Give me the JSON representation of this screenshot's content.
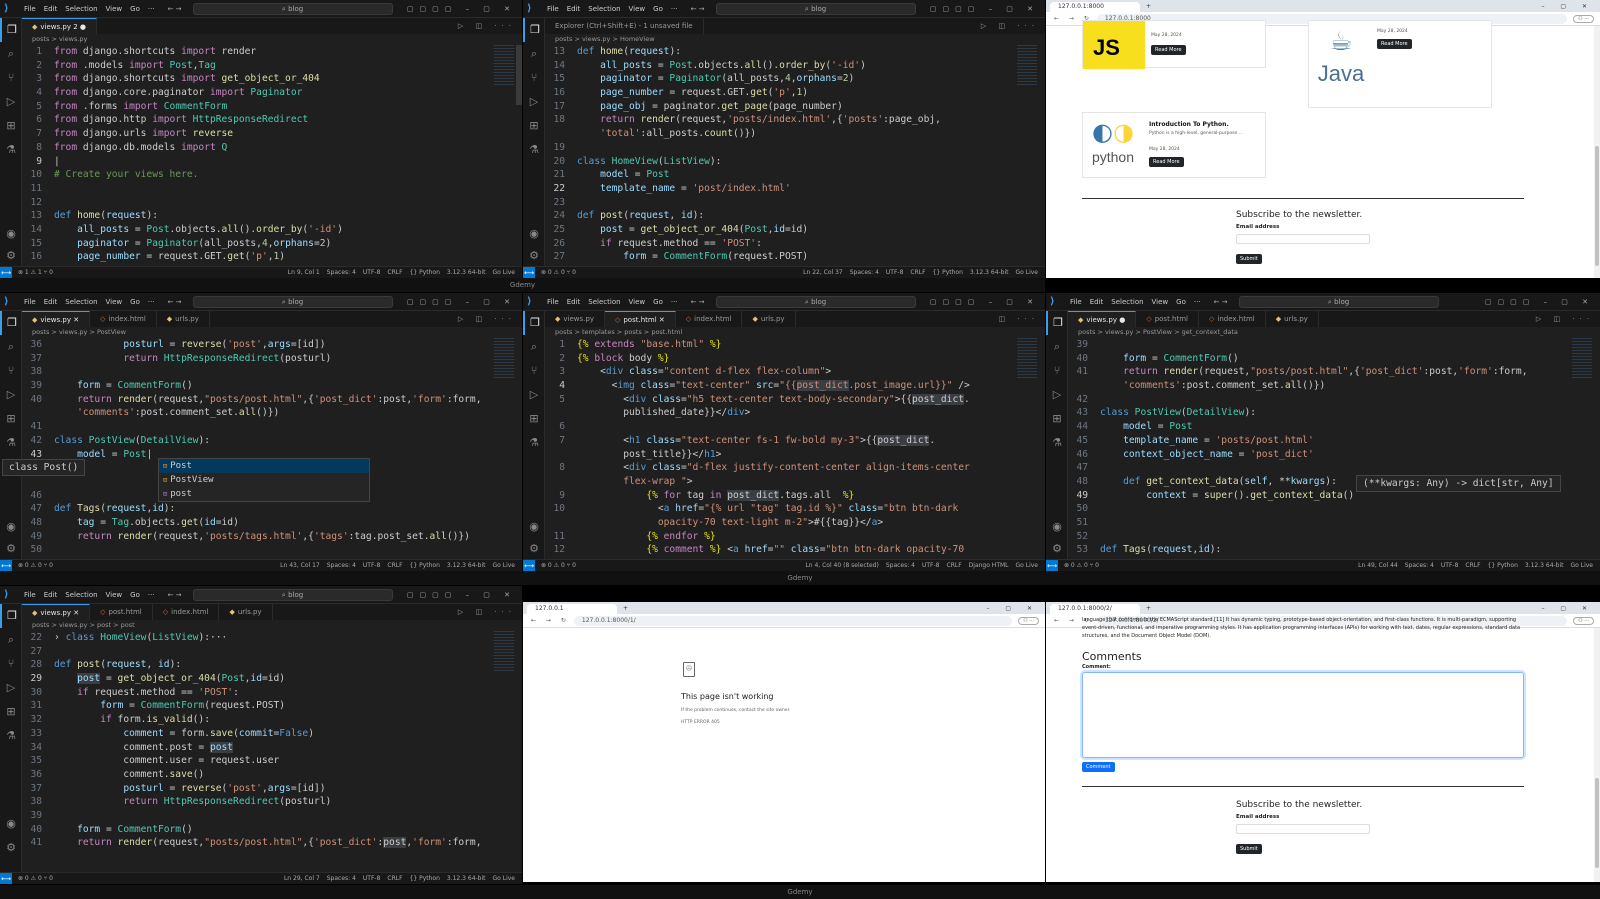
{
  "menu": {
    "file": "File",
    "edit": "Edit",
    "selection": "Selection",
    "view": "View",
    "go": "Go",
    "more": "···"
  },
  "search_text": "blog",
  "window_label": "Gdemy",
  "p1": {
    "tab": "views.py 2",
    "crumb": "posts > views.py",
    "status_left": "⊗ 1 ⚠ 1  ⑂ 0",
    "status_right": [
      "Ln 9, Col 1",
      "Spaces: 4",
      "UTF-8",
      "CRLF",
      "{} Python",
      "3.12.3 64-bit",
      "Go Live"
    ]
  },
  "p2": {
    "tab": "Explorer (Ctrl+Shift+E) - 1 unsaved file",
    "crumb": "posts > views.py > HomeView",
    "status_left": "⊗ 0 ⚠ 0  ⑂ 0",
    "status_right": [
      "Ln 22, Col 37",
      "Spaces: 4",
      "UTF-8",
      "CRLF",
      "{} Python",
      "3.12.3 64-bit",
      "Go Live"
    ]
  },
  "p3": {
    "tabs": [
      "views.py",
      "index.html",
      "urls.py"
    ],
    "crumb": "posts > views.py > PostView",
    "status_left": "⊗ 0 ⚠ 0  ⑂ 0",
    "status_right": [
      "Ln 43, Col 17",
      "Spaces: 4",
      "UTF-8",
      "CRLF",
      "{} Python",
      "3.12.3 64-bit",
      "Go Live"
    ],
    "hover": "class Post()",
    "autocomplete": [
      "Post",
      "PostView",
      "post"
    ]
  },
  "p4": {
    "tabs": [
      "views.py",
      "post.html",
      "index.html",
      "urls.py"
    ],
    "crumb": "posts > templates > posts > post.html",
    "status_left": "⊗ 0 ⚠ 0  ⑂ 0",
    "status_right": [
      "Ln 4, Col 40 (8 selected)",
      "Spaces: 4",
      "UTF-8",
      "CRLF",
      "Django HTML",
      "Go Live"
    ]
  },
  "p5": {
    "tabs": [
      "views.py",
      "post.html",
      "index.html",
      "urls.py"
    ],
    "crumb": "posts > views.py > PostView > get_context_data",
    "status_left": "⊗ 0 ⚠ 0  ⑂ 0",
    "status_right": [
      "Ln 49, Col 44",
      "Spaces: 4",
      "UTF-8",
      "CRLF",
      "{} Python",
      "3.12.3 64-bit",
      "Go Live"
    ],
    "hover": "(**kwargs: Any) -> dict[str, Any]"
  },
  "p7": {
    "tabs": [
      "views.py",
      "post.html",
      "index.html",
      "urls.py"
    ],
    "crumb": "posts > views.py > post > post",
    "status_left": "⊗ 0 ⚠ 0  ⑂ 0",
    "status_right": [
      "Ln 29, Col 7",
      "Spaces: 4",
      "UTF-8",
      "CRLF",
      "{} Python",
      "3.12.3 64-bit",
      "Go Live"
    ]
  },
  "browser1": {
    "tab": "127.0.0.1:8000",
    "url": "127.0.0.1:8000",
    "js_date": "May 28, 2024",
    "java_date": "May 28, 2024",
    "python_title": "Introduction To Python.",
    "python_desc": "Python is a high-level, general-purpose ...",
    "python_date": "May 28, 2024",
    "read_more": "Read More",
    "js_logo": "JS",
    "java_logo": "Java",
    "python_logo": "python",
    "newsletter": "Subscribe to the newsletter.",
    "email_label": "Email address",
    "submit": "Submit"
  },
  "browser2": {
    "tab": "127.0.0.1",
    "url": "127.0.0.1:8000/1/",
    "title": "This page isn't working",
    "desc": "If the problem continues, contact the site owner.",
    "code": "HTTP ERROR 405"
  },
  "browser3": {
    "tab": "127.0.0.1:8000/2/",
    "url": "127.0.0.1:8000/2/",
    "para": "language that conforms to the ECMAScript standard.[11] It has dynamic typing, prototype-based object-orientation, and first-class functions. It is multi-paradigm, supporting event-driven, functional, and imperative programming styles. It has application programming interfaces (APIs) for working with text, dates, regular expressions, standard data structures, and the Document Object Model (DOM).",
    "comments": "Comments",
    "comment_label": "Comment:",
    "comment_btn": "Comment",
    "newsletter": "Subscribe to the newsletter.",
    "email_label": "Email address",
    "submit": "Submit"
  }
}
